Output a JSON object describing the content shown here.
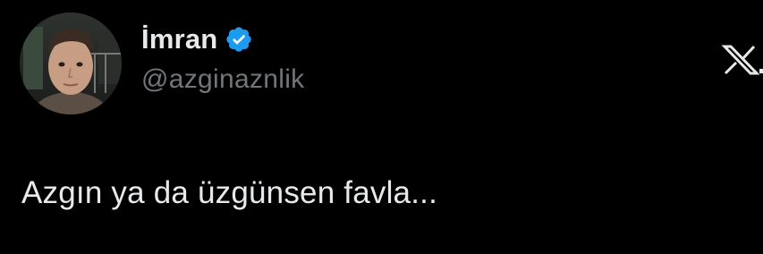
{
  "tweet": {
    "author": {
      "display_name": "İmran",
      "handle": "@azginaznlik",
      "verified": true,
      "avatar": "profile-photo"
    },
    "text": "Azgın ya da üzgünsen favla...",
    "platform_icon": "x-logo-icon"
  },
  "colors": {
    "background": "#000000",
    "primary_text": "#e7e9ea",
    "secondary_text": "#71767b",
    "verified_blue": "#1d9bf0"
  }
}
